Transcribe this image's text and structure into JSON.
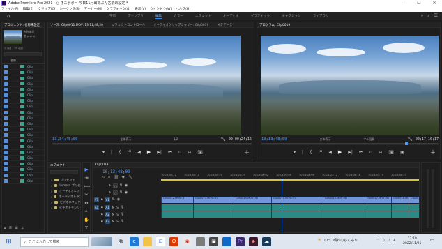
{
  "window": {
    "title": "Adobe Premiere Pro 2021 - ○ オニポポー 今日11月出荷ぶん名前未設定 *",
    "controls": [
      "—",
      "☐",
      "✕"
    ]
  },
  "menu": [
    "ファイル(F)",
    "編集(E)",
    "クリップ(C)",
    "シーケンス(S)",
    "マーカー(M)",
    "グラフィック(G)",
    "表示(V)",
    "ウィンドウ(W)",
    "ヘルプ(H)"
  ],
  "workspaces": {
    "tabs": [
      "学習",
      "アセンブリ",
      "編集",
      "カラー",
      "エフェクト",
      "オーディオ",
      "グラフィック",
      "キャプション",
      "ライブラリ"
    ],
    "active": "編集"
  },
  "project_panel": {
    "tabs": [
      "プロジェクト: 名称未設定",
      "メディア"
    ],
    "file_title": "名称未設定.prproj",
    "item_count": "2 項目 / 36 項目",
    "column_header": "名前",
    "rows": [
      "Clip",
      "Clip",
      "Clip",
      "Clip",
      "Clip",
      "Clip",
      "Clip",
      "Clip",
      "Clip",
      "Clip",
      "Clip",
      "Clip",
      "Clip",
      "Clip",
      "Clip",
      "Clip",
      "Clip",
      "Clip",
      "Clip",
      "Clip",
      "Clip"
    ]
  },
  "source_monitor": {
    "tabs": [
      "ソース: Clip0011.MOV: 13,11,48,20",
      "エフェクトコントロール",
      "オーディオクリップミキサー: Clip0019",
      "メタデータ"
    ],
    "timecode_in": "13,34;45;00",
    "fit": "全体表示",
    "resolution": "1/2",
    "duration": "00;00;24;15"
  },
  "program_monitor": {
    "tab": "プログラム: Clip0019",
    "timecode": "10;13;48;09",
    "fit": "全体表示",
    "resolution": "フル画質",
    "duration": "00;17;10;17"
  },
  "effects_panel": {
    "tabs": [
      "エフェクト",
      "マーカー"
    ],
    "items": [
      "プリセット",
      "Lumetri プリセット",
      "オーディオエフェクト",
      "オーディオトランジション",
      "ビデオエフェクト",
      "ビデオトランジション"
    ]
  },
  "tools": [
    "▶",
    "⇥",
    "⟺",
    "✂",
    "↔",
    "✒",
    "✋",
    "T"
  ],
  "timeline": {
    "tab": "Clip0019",
    "timecode": "10;13;48;09",
    "ruler": [
      "10;12;35;12",
      "10;12;50;15",
      "10;13;05;20",
      "10;13;20;24",
      "10;13;36;02",
      "10;13;51;05",
      "10;14;06;09",
      "10;14;21;12",
      "10;14;36;16",
      "10;14;51;19",
      "10;15;06;23"
    ],
    "video_tracks": [
      "V3",
      "V2",
      "V1"
    ],
    "audio_tracks": [
      "A1",
      "A2",
      "A3"
    ],
    "clips": [
      "Clip0012.MOV [V]",
      "Clip0013.MOV [V]",
      "Clip0014.MOV [V]",
      "Clip0015.MOV [V]",
      "Clip0016.MOV [V]",
      "Clip0017.MOV [V]",
      "Clip0018.MOV [V]",
      "Clip0019.MOV [V]"
    ]
  },
  "taskbar": {
    "search_placeholder": "ここに入力して検索",
    "weather": "17°C  晴れのちくもり",
    "time": "17:19",
    "date": "2022/11/21"
  },
  "colors": {
    "accent": "#2d8ceb",
    "timecode": "#4d9bff",
    "video_clip": "#7395d9",
    "audio_clip": "#2a8a86"
  }
}
